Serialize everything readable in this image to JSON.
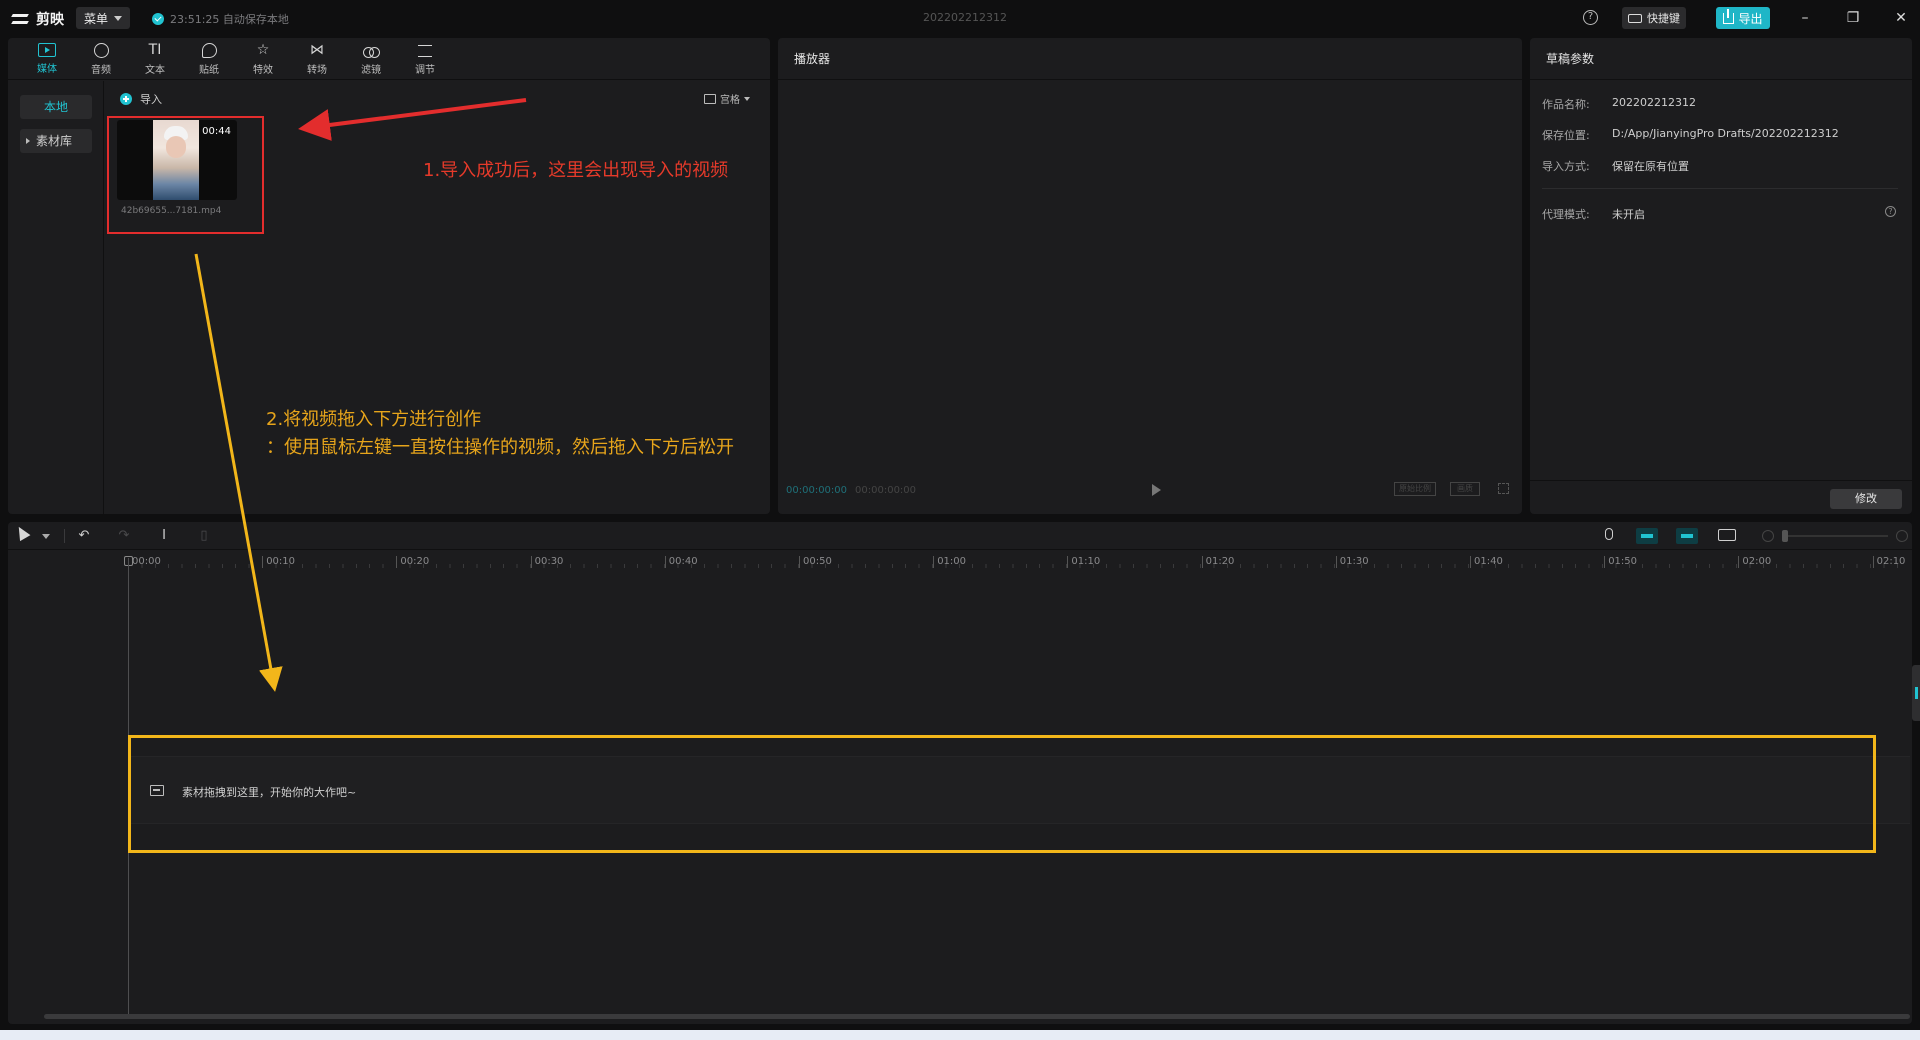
{
  "titlebar": {
    "app_name": "剪映",
    "menu_label": "菜单",
    "autosave_text": "23:51:25 自动保存本地",
    "project_title": "202202212312",
    "help_glyph": "?",
    "shortcut_label": "快捷键",
    "export_label": "导出",
    "window_controls": {
      "minimize": "–",
      "maximize": "❐",
      "close": "✕"
    }
  },
  "media": {
    "tabs": [
      {
        "label": "媒体",
        "icon": "media-icon",
        "active": true
      },
      {
        "label": "音频",
        "icon": "audio-icon",
        "active": false
      },
      {
        "label": "文本",
        "icon": "text-icon",
        "glyph": "TI",
        "active": false
      },
      {
        "label": "贴纸",
        "icon": "sticker-icon",
        "active": false
      },
      {
        "label": "特效",
        "icon": "effects-icon",
        "glyph": "☆",
        "active": false
      },
      {
        "label": "转场",
        "icon": "transition-icon",
        "glyph": "⋈",
        "active": false
      },
      {
        "label": "滤镜",
        "icon": "filter-icon",
        "active": false
      },
      {
        "label": "调节",
        "icon": "adjust-icon",
        "active": false
      }
    ],
    "side_nav": {
      "local": "本地",
      "library": "素材库"
    },
    "import_label": "导入",
    "view_label": "宫格",
    "clip": {
      "duration": "00:44",
      "filename": "42b69655...7181.mp4"
    }
  },
  "annotations": {
    "step1": "1.导入成功后，这里会出现导入的视频",
    "step2_line1": "2.将视频拖入下方进行创作",
    "step2_line2": "：使用鼠标左键一直按住操作的视频，然后拖入下方后松开",
    "red": "#e32d2d",
    "yellow": "#f2b61a"
  },
  "player": {
    "title": "播放器",
    "current_time": "00:00:00:00",
    "total_time": "00:00:00:00",
    "ratio_label": "原始比例",
    "quality_label": "画质"
  },
  "draft": {
    "title": "草稿参数",
    "rows": [
      {
        "label": "作品名称:",
        "value": "202202212312"
      },
      {
        "label": "保存位置:",
        "value": "D:/App/JianyingPro Drafts/202202212312"
      },
      {
        "label": "导入方式:",
        "value": "保留在原有位置"
      },
      {
        "label": "代理模式:",
        "value": "未开启"
      }
    ],
    "info_glyph": "?",
    "modify_label": "修改"
  },
  "timeline": {
    "ticks": [
      "00:00",
      "00:10",
      "00:20",
      "00:30",
      "00:40",
      "00:50",
      "01:00",
      "01:10",
      "01:20",
      "01:30",
      "01:40",
      "01:50",
      "02:00",
      "02:10"
    ],
    "drop_hint": "素材拖拽到这里，开始你的大作吧~",
    "tools": {
      "undo": "↶",
      "redo": "↷",
      "split": "I",
      "delete": "▯"
    }
  },
  "colors": {
    "accent": "#21c3d1",
    "panel": "#1c1c1e",
    "background": "#0f0f10"
  }
}
